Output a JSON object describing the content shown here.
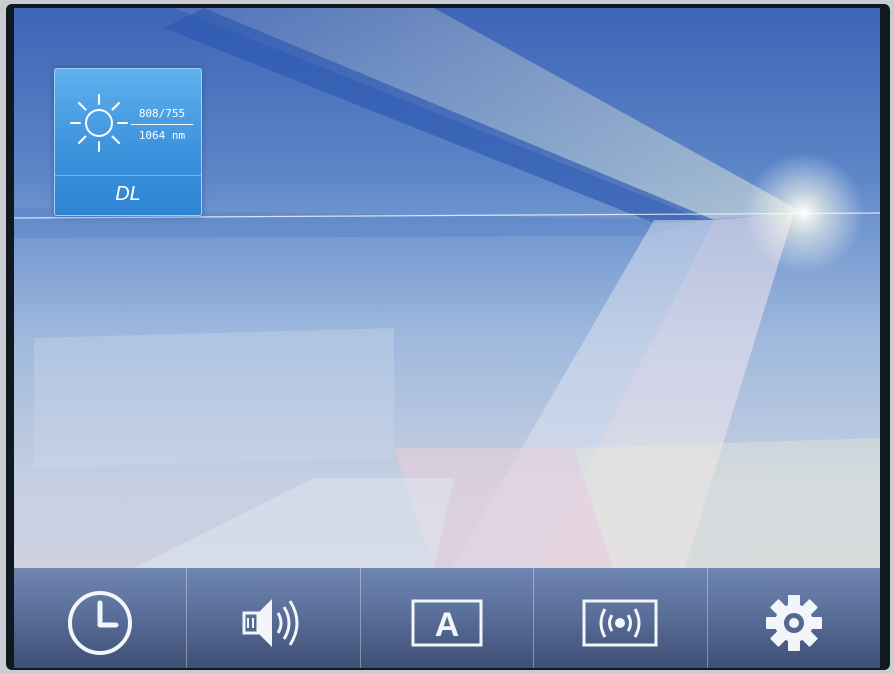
{
  "main_tile": {
    "label": "DL",
    "spec_top": "808/755",
    "spec_bottom": "1064 nm",
    "icon": "sun-icon"
  },
  "toolbar": {
    "buttons": [
      {
        "id": "clock",
        "icon": "clock-icon"
      },
      {
        "id": "sound",
        "icon": "speaker-icon"
      },
      {
        "id": "language",
        "icon": "letter-a-icon",
        "text": "A"
      },
      {
        "id": "signal",
        "icon": "wireless-signal-icon"
      },
      {
        "id": "settings",
        "icon": "gear-icon"
      }
    ]
  },
  "colors": {
    "tile_blue": "#3d93dc",
    "bar_blue": "#5a6f9a",
    "icon_white": "#f2f5f9"
  }
}
